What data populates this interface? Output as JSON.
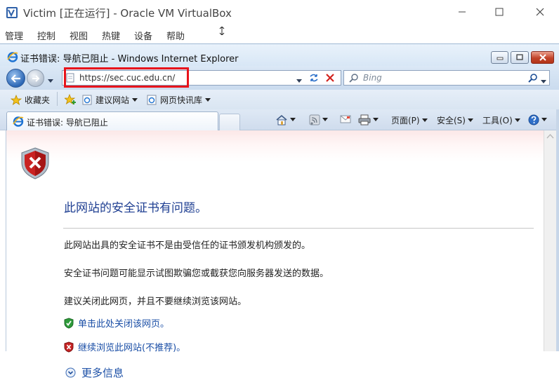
{
  "vbox": {
    "title": "Victim [正在运行] - Oracle VM VirtualBox",
    "menu": [
      "管理",
      "控制",
      "视图",
      "热键",
      "设备",
      "帮助"
    ]
  },
  "ie": {
    "title": "证书错误: 导航已阻止 - Windows Internet Explorer",
    "address": "https://sec.cuc.edu.cn/",
    "search_placeholder": "Bing",
    "favorites_label": "收藏夹",
    "fav_links": [
      "建议网站",
      "网页快讯库"
    ],
    "tab_title": "证书错误: 导航已阻止",
    "commands": {
      "page": "页面(P)",
      "safety": "安全(S)",
      "tools": "工具(O)"
    }
  },
  "error_page": {
    "heading": "此网站的安全证书有问题。",
    "paragraphs": [
      "此网站出具的安全证书不是由受信任的证书颁发机构颁发的。",
      "安全证书问题可能显示试图欺骗您或截获您向服务器发送的数据。",
      "建议关闭此网页，并且不要继续浏览该网站。"
    ],
    "close_link": "单击此处关闭该网页。",
    "continue_link": "继续浏览此网站(不推荐)。",
    "more_info": "更多信息"
  },
  "colors": {
    "highlight": "#e8141c",
    "heading": "#1f3f92",
    "link": "#1a4ea6"
  },
  "icons": [
    "virtualbox-icon",
    "minimize-icon",
    "maximize-icon",
    "close-icon",
    "ie-logo-icon",
    "back-icon",
    "forward-icon",
    "refresh-icon",
    "stop-icon",
    "search-icon",
    "favorites-star-icon",
    "add-favorite-icon",
    "home-icon",
    "feeds-icon",
    "mail-icon",
    "print-icon",
    "help-icon",
    "shield-error-icon",
    "shield-ok-icon",
    "shield-warning-icon",
    "expand-icon"
  ]
}
